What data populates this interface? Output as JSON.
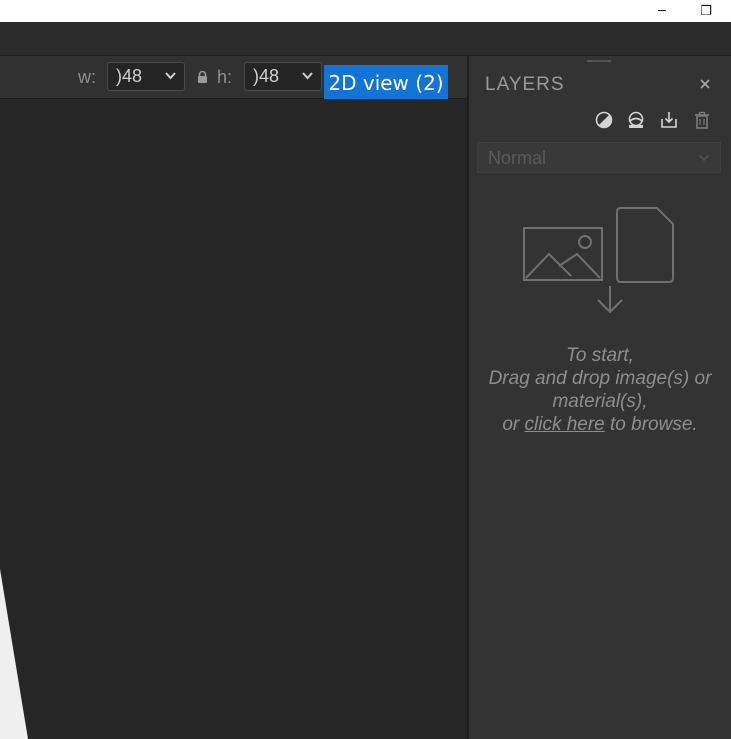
{
  "window": {
    "minimize_glyph": "─",
    "restore_glyph": "❐"
  },
  "toolbar": {
    "width_label": "w:",
    "width_value": ")48",
    "height_label": "h:",
    "height_value": ")48",
    "view_tag": "2D view (2)"
  },
  "layers": {
    "title": "LAYERS",
    "close_glyph": "×",
    "blend_mode": "Normal",
    "drop_line1": "To start,",
    "drop_line2": "Drag and drop image(s) or",
    "drop_line3": "material(s),",
    "drop_prefix": "or ",
    "drop_link": "click here",
    "drop_suffix": " to browse.",
    "icons": [
      "contrast-icon",
      "material-icon",
      "import-icon",
      "trash-icon"
    ]
  },
  "colors": {
    "accent": "#1274d4",
    "panel_bg": "#333333",
    "canvas_bg": "#262626"
  }
}
